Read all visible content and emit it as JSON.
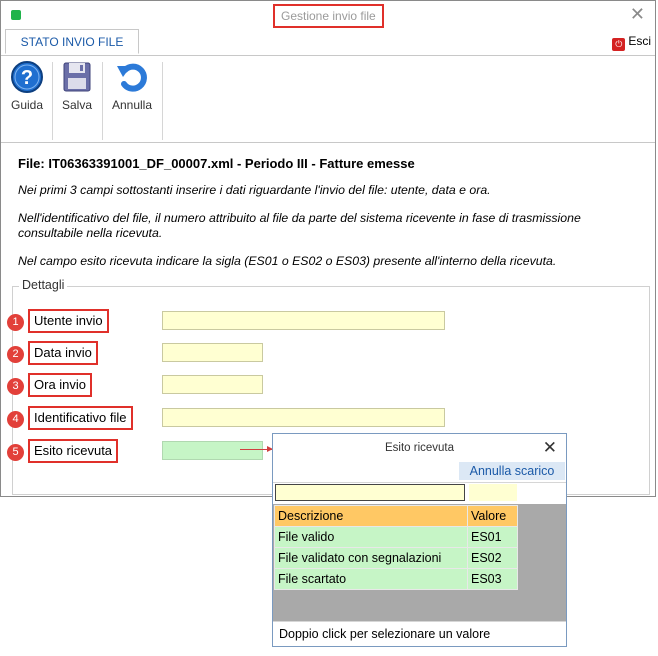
{
  "window": {
    "title": "Gestione invio file"
  },
  "tabs": [
    {
      "label": "STATO INVIO FILE"
    }
  ],
  "exit_label": "Esci",
  "exit_icon": "exit-icon",
  "toolbar": {
    "buttons": [
      {
        "label": "Guida",
        "icon": "help-icon"
      },
      {
        "label": "Salva",
        "icon": "floppy-disk-icon"
      },
      {
        "label": "Annulla",
        "icon": "undo-arrow-icon"
      }
    ]
  },
  "content": {
    "file_title": "File: IT06363391001_DF_00007.xml - Periodo III - Fatture emesse",
    "paragraphs": [
      "Nei primi 3 campi sottostanti inserire i dati riguardante l'invio del file: utente, data e ora.",
      "Nell'identificativo del file, il numero attribuito al file da parte del sistema ricevente in fase di trasmissione consultabile nella ricevuta.",
      "Nel campo esito ricevuta indicare la sigla (ES01 o ES02 o ES03) presente all'interno della ricevuta."
    ]
  },
  "details": {
    "label": "Dettagli",
    "fields": [
      {
        "number": "1",
        "label": "Utente invio",
        "value": ""
      },
      {
        "number": "2",
        "label": "Data invio",
        "value": ""
      },
      {
        "number": "3",
        "label": "Ora invio",
        "value": ""
      },
      {
        "number": "4",
        "label": "Identificativo file",
        "value": ""
      },
      {
        "number": "5",
        "label": "Esito ricevuta",
        "value": ""
      }
    ]
  },
  "popup": {
    "title": "Esito ricevuta",
    "annulla_label": "Annulla scarico",
    "columns": [
      "Descrizione",
      "Valore"
    ],
    "rows": [
      {
        "descrizione": "File valido",
        "valore": "ES01"
      },
      {
        "descrizione": "File validato con segnalazioni",
        "valore": "ES02"
      },
      {
        "descrizione": "File scartato",
        "valore": "ES03"
      }
    ],
    "footer": "Doppio click per selezionare un valore"
  },
  "colors": {
    "accent": "#1b5aa8",
    "highlight_border": "#e0302a",
    "field_yellow": "#ffffd2",
    "field_green": "#c6f5c6",
    "header_orange": "#ffc864"
  }
}
